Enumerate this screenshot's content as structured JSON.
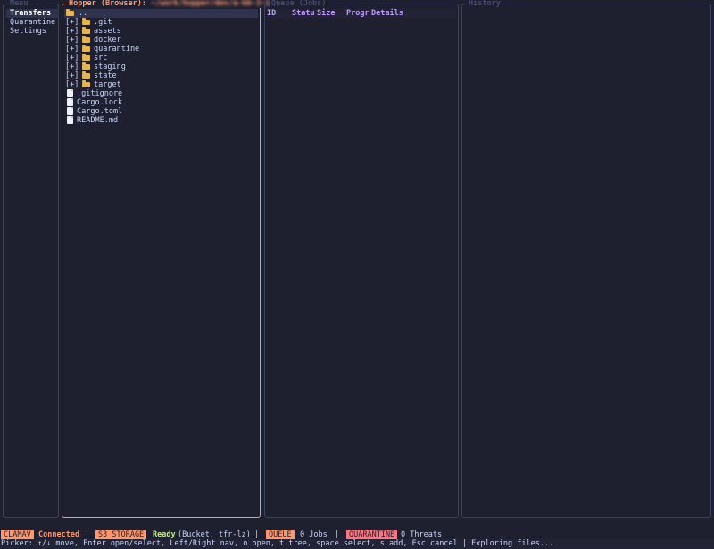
{
  "menu": {
    "title": "Menu",
    "items": [
      {
        "label": "Transfers",
        "selected": true
      },
      {
        "label": "Quarantine",
        "selected": false
      },
      {
        "label": "Settings",
        "selected": false
      }
    ]
  },
  "hopper": {
    "title": "Hopper (Browser):",
    "path": "~/work/hopper/dev/a-bb-3-1a",
    "entries": [
      {
        "name": "..",
        "type": "parent",
        "selected": true
      },
      {
        "name": ".git",
        "type": "dir",
        "expander": "[+]"
      },
      {
        "name": "assets",
        "type": "dir",
        "expander": "[+]"
      },
      {
        "name": "docker",
        "type": "dir",
        "expander": "[+]"
      },
      {
        "name": "quarantine",
        "type": "dir",
        "expander": "[+]"
      },
      {
        "name": "src",
        "type": "dir",
        "expander": "[+]"
      },
      {
        "name": "staging",
        "type": "dir",
        "expander": "[+]"
      },
      {
        "name": "state",
        "type": "dir",
        "expander": "[+]"
      },
      {
        "name": "target",
        "type": "dir",
        "expander": "[+]"
      },
      {
        "name": ".gitignore",
        "type": "file"
      },
      {
        "name": "Cargo.lock",
        "type": "file"
      },
      {
        "name": "Cargo.toml",
        "type": "file"
      },
      {
        "name": "README.md",
        "type": "file"
      }
    ]
  },
  "queue": {
    "title": "Queue (Jobs)",
    "columns": [
      "ID",
      "Statu",
      "Size",
      "Progr",
      "Details"
    ]
  },
  "history": {
    "title": "History"
  },
  "status": {
    "clamav_label": "CLAMAV",
    "clamav_value": "Connected",
    "sep1": "|",
    "s3_label": "S3 STORAGE",
    "s3_state": "Ready",
    "s3_bucket": "(Bucket: tfr-lz)",
    "sep2": "|",
    "queue_label": "QUEUE",
    "queue_value": "0 Jobs",
    "sep3": "|",
    "quarantine_label": "QUARANTINE",
    "quarantine_value": "0 Threats"
  },
  "help": {
    "text": "Picker: ↑/↓ move, Enter open/select, Left/Right nav, o open, t tree, space select, s add, Esc cancel | Exploring files..."
  },
  "colors": {
    "background": "#1e2030",
    "accent_orange": "#ff966c",
    "accent_purple": "#c099ff",
    "success_green": "#c3e88d",
    "danger_pink": "#ff757f",
    "folder_yellow": "#e6b450"
  }
}
